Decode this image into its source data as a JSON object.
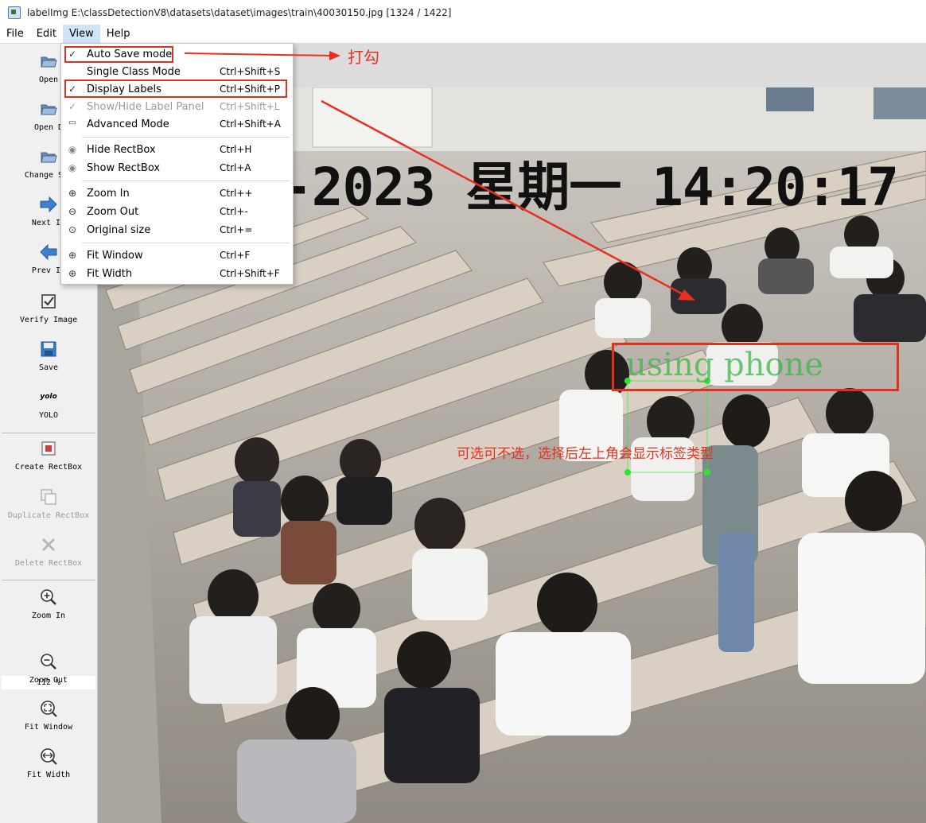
{
  "window": {
    "title": "labelImg E:\\classDetectionV8\\datasets\\dataset\\images\\train\\40030150.jpg [1324 / 1422]"
  },
  "menubar": {
    "file": "File",
    "edit": "Edit",
    "view": "View",
    "help": "Help"
  },
  "toolbar": {
    "open": "Open",
    "open_dir": "Open D",
    "change_save": "Change Sav",
    "next_image": "Next Im",
    "prev_image": "Prev Im",
    "verify_image": "Verify Image",
    "save": "Save",
    "yolo_icon_text": "yolo",
    "yolo": "YOLO",
    "create_rectbox": "Create RectBox",
    "duplicate_rectbox": "Duplicate RectBox",
    "delete_rectbox": "Delete RectBox",
    "zoom_in": "Zoom In",
    "zoom_value": "112 %",
    "zoom_out": "Zoom Out",
    "fit_window": "Fit Window",
    "fit_width": "Fit Width"
  },
  "view_menu": {
    "items": [
      {
        "label": "Auto Save mode",
        "shortcut": "",
        "checked": true
      },
      {
        "label": "Single Class Mode",
        "shortcut": "Ctrl+Shift+S",
        "checked": false
      },
      {
        "label": "Display Labels",
        "shortcut": "Ctrl+Shift+P",
        "checked": true
      },
      {
        "label": "Show/Hide Label Panel",
        "shortcut": "Ctrl+Shift+L",
        "checked": true,
        "disabled": true
      },
      {
        "label": "Advanced Mode",
        "shortcut": "Ctrl+Shift+A",
        "checked": false
      },
      {
        "label": "Hide RectBox",
        "shortcut": "Ctrl+H"
      },
      {
        "label": "Show RectBox",
        "shortcut": "Ctrl+A"
      },
      {
        "label": "Zoom In",
        "shortcut": "Ctrl++"
      },
      {
        "label": "Zoom Out",
        "shortcut": "Ctrl+-"
      },
      {
        "label": "Original size",
        "shortcut": "Ctrl+="
      },
      {
        "label": "Fit Window",
        "shortcut": "Ctrl+F"
      },
      {
        "label": "Fit Width",
        "shortcut": "Ctrl+Shift+F"
      }
    ]
  },
  "annotations": {
    "tick_note": "打勾",
    "optional_note": "可选可不选，选择后左上角会显示标签类型"
  },
  "image": {
    "timestamp": "-2023 星期一 14:20:17",
    "label_name": "using phone"
  },
  "colors": {
    "annotation_red": "#e0301e",
    "label_green": "#3cb54a",
    "menu_highlight": "#cde4f7"
  }
}
